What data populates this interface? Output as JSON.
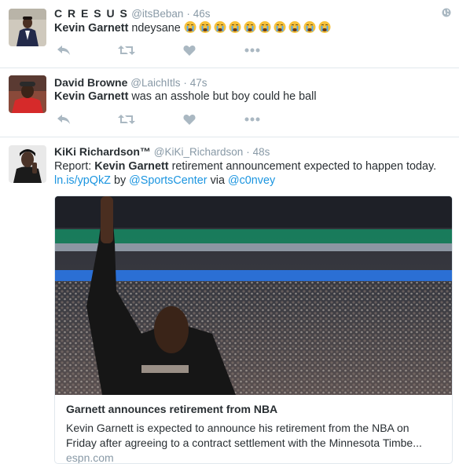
{
  "tweets": [
    {
      "name": "C R E S U S",
      "handle": "@itsBeban",
      "separator": "·",
      "time": "46s",
      "mention": "Kevin Garnett",
      "text_rest": " ndeysane",
      "emoji": "😭😭😭😭😭😭😭😭😭😭"
    },
    {
      "name": "David Browne",
      "handle": "@LaichItls",
      "separator": "·",
      "time": "47s",
      "mention": "Kevin Garnett",
      "text_rest": " was an asshole but boy could he ball"
    },
    {
      "name": "KiKi Richardson™",
      "handle": "@KiKi_Richardson",
      "separator": "·",
      "time": "48s",
      "text_prefix": "Report: ",
      "mention": "Kevin Garnett",
      "text_rest": " retirement announcement expected to happen today.",
      "link": "ln.is/ypQkZ",
      "by_word": " by ",
      "by_user": "@SportsCenter",
      "via_word": " via ",
      "via_user": "@c0nvey",
      "card": {
        "title": "Garnett announces retirement from NBA",
        "description_line1": "Kevin Garnett is expected to announce his retirement from the NBA on",
        "description_line2": "Friday after agreeing to a contract settlement with the Minnesota Timbe...",
        "domain": "espn.com"
      }
    }
  ],
  "colors": {
    "text": "#292f33",
    "muted": "#8899a6",
    "link": "#1b95e0",
    "action_icon": "#aab8c2",
    "border": "#e1e8ed"
  },
  "icons": [
    "reply-icon",
    "retweet-icon",
    "like-icon",
    "more-icon",
    "globe-icon"
  ]
}
